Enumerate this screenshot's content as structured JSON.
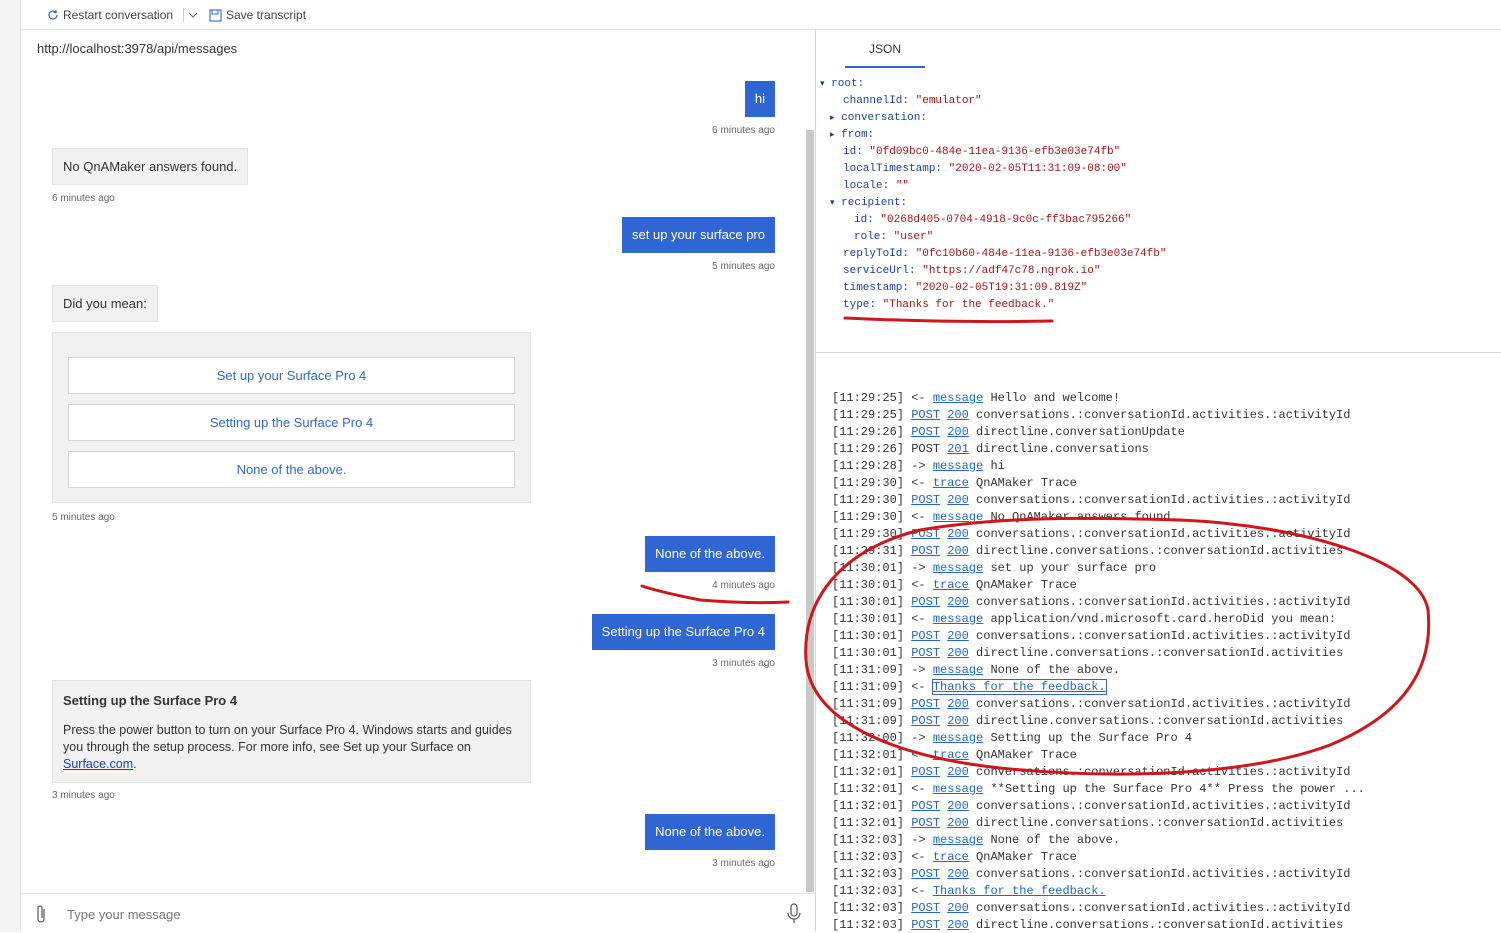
{
  "toolbar": {
    "restart_label": "Restart conversation",
    "save_label": "Save transcript"
  },
  "chat": {
    "endpoint": "http://localhost:3978/api/messages",
    "messages": [
      {
        "from": "user",
        "text": "hi",
        "time": "6 minutes ago"
      },
      {
        "from": "bot",
        "text": "No QnAMaker answers found.",
        "time": "6 minutes ago"
      },
      {
        "from": "user",
        "text": "set up your surface pro",
        "time": "5 minutes ago"
      },
      {
        "from": "bot",
        "text": "Did you mean:",
        "time": ""
      },
      {
        "from": "user",
        "text": "None of the above.",
        "time": "4 minutes ago"
      },
      {
        "from": "user",
        "text": "Setting up the Surface Pro 4",
        "time": "3 minutes ago"
      },
      {
        "from": "user",
        "text": "None of the above.",
        "time": "3 minutes ago"
      }
    ],
    "card": {
      "buttons": [
        "Set up your Surface Pro 4",
        "Setting up the Surface Pro 4",
        "None of the above."
      ],
      "time": "5 minutes ago"
    },
    "answer": {
      "title": "Setting up the Surface Pro 4",
      "body": "Press the power button to turn on your Surface Pro 4. Windows starts and guides you through the setup process. For more info, see Set up your Surface on ",
      "link": "Surface.com",
      "end": ".",
      "time": "3 minutes ago"
    },
    "input_placeholder": "Type your message"
  },
  "inspector": {
    "tab": "JSON",
    "json_lines": [
      {
        "arrow": "▾",
        "key": "root:",
        "val": ""
      },
      {
        "arrow": "",
        "key": "channelId:",
        "val": "\"emulator\""
      },
      {
        "arrow": "▸",
        "key": "conversation:",
        "val": ""
      },
      {
        "arrow": "▸",
        "key": "from:",
        "val": ""
      },
      {
        "arrow": "",
        "key": "id:",
        "val": "\"0fd09bc0-484e-11ea-9136-efb3e03e74fb\""
      },
      {
        "arrow": "",
        "key": "localTimestamp:",
        "val": "\"2020-02-05T11:31:09-08:00\""
      },
      {
        "arrow": "",
        "key": "locale:",
        "val": "\"\""
      },
      {
        "arrow": "▾",
        "key": "recipient:",
        "val": ""
      },
      {
        "arrow": "",
        "key": "id:",
        "val": "\"0268d405-0704-4918-9c0c-ff3bac795266\""
      },
      {
        "arrow": "",
        "key": "role:",
        "val": "\"user\""
      },
      {
        "arrow": "",
        "key": "replyToId:",
        "val": "\"0fc10b60-484e-11ea-9136-efb3e03e74fb\""
      },
      {
        "arrow": "",
        "key": "serviceUrl:",
        "val": "\"https://adf47c78.ngrok.io\""
      },
      {
        "arrow": "",
        "key": "timestamp:",
        "val": "\"2020-02-05T19:31:09.819Z\""
      },
      {
        "arrow": "",
        "key": "type:",
        "val": "\"Thanks for the feedback.\""
      }
    ]
  },
  "log": [
    {
      "t": "[11:29:25]",
      "d": "<-",
      "tag": "message",
      "code": "",
      "rest": "Hello and welcome!"
    },
    {
      "t": "[11:29:25]",
      "d": "",
      "tag": "POST",
      "code": "200",
      "rest": "conversations.:conversationId.activities.:activityId"
    },
    {
      "t": "[11:29:26]",
      "d": "",
      "tag": "POST",
      "code": "200",
      "rest": "directline.conversationUpdate"
    },
    {
      "t": "[11:29:26]",
      "d": "",
      "tag": "POST",
      "plain": true,
      "code": "201",
      "rest": "directline.conversations"
    },
    {
      "t": "[11:29:28]",
      "d": "->",
      "tag": "message",
      "code": "",
      "rest": "hi"
    },
    {
      "t": "[11:29:30]",
      "d": "<-",
      "tag": "trace",
      "code": "",
      "rest": "QnAMaker Trace"
    },
    {
      "t": "[11:29:30]",
      "d": "",
      "tag": "POST",
      "code": "200",
      "rest": "conversations.:conversationId.activities.:activityId"
    },
    {
      "t": "[11:29:30]",
      "d": "<-",
      "tag": "message",
      "code": "",
      "rest": "No QnAMaker answers found."
    },
    {
      "t": "[11:29:30]",
      "d": "",
      "tag": "POST",
      "code": "200",
      "rest": "conversations.:conversationId.activities.:activityId"
    },
    {
      "t": "[11:29:31]",
      "d": "",
      "tag": "POST",
      "code": "200",
      "rest": "directline.conversations.:conversationId.activities"
    },
    {
      "t": "[11:30:01]",
      "d": "->",
      "tag": "message",
      "code": "",
      "rest": "set up your surface pro"
    },
    {
      "t": "[11:30:01]",
      "d": "<-",
      "tag": "trace",
      "code": "",
      "rest": "QnAMaker Trace"
    },
    {
      "t": "[11:30:01]",
      "d": "",
      "tag": "POST",
      "code": "200",
      "rest": "conversations.:conversationId.activities.:activityId"
    },
    {
      "t": "[11:30:01]",
      "d": "<-",
      "tag": "message",
      "code": "",
      "rest": "application/vnd.microsoft.card.heroDid you mean:"
    },
    {
      "t": "[11:30:01]",
      "d": "",
      "tag": "POST",
      "code": "200",
      "rest": "conversations.:conversationId.activities.:activityId"
    },
    {
      "t": "[11:30:01]",
      "d": "",
      "tag": "POST",
      "code": "200",
      "rest": "directline.conversations.:conversationId.activities"
    },
    {
      "t": "[11:31:09]",
      "d": "->",
      "tag": "message",
      "code": "",
      "rest": "None of the above."
    },
    {
      "t": "[11:31:09]",
      "d": "<-",
      "tag": "Thanks for the feedback.",
      "selected": true,
      "code": "",
      "rest": ""
    },
    {
      "t": "[11:31:09]",
      "d": "",
      "tag": "POST",
      "code": "200",
      "rest": "conversations.:conversationId.activities.:activityId"
    },
    {
      "t": "[11:31:09]",
      "d": "",
      "tag": "POST",
      "code": "200",
      "rest": "directline.conversations.:conversationId.activities"
    },
    {
      "t": "[11:32:00]",
      "d": "->",
      "tag": "message",
      "code": "",
      "rest": "Setting up the Surface Pro 4"
    },
    {
      "t": "[11:32:01]",
      "d": "<-",
      "tag": "trace",
      "code": "",
      "rest": "QnAMaker Trace"
    },
    {
      "t": "[11:32:01]",
      "d": "",
      "tag": "POST",
      "code": "200",
      "rest": "conversations.:conversationId.activities.:activityId"
    },
    {
      "t": "[11:32:01]",
      "d": "<-",
      "tag": "message",
      "code": "",
      "rest": "**Setting up the Surface Pro 4** Press the power ..."
    },
    {
      "t": "[11:32:01]",
      "d": "",
      "tag": "POST",
      "code": "200",
      "rest": "conversations.:conversationId.activities.:activityId"
    },
    {
      "t": "[11:32:01]",
      "d": "",
      "tag": "POST",
      "code": "200",
      "rest": "directline.conversations.:conversationId.activities"
    },
    {
      "t": "[11:32:03]",
      "d": "->",
      "tag": "message",
      "code": "",
      "rest": "None of the above."
    },
    {
      "t": "[11:32:03]",
      "d": "<-",
      "tag": "trace",
      "code": "",
      "rest": "QnAMaker Trace"
    },
    {
      "t": "[11:32:03]",
      "d": "",
      "tag": "POST",
      "code": "200",
      "rest": "conversations.:conversationId.activities.:activityId"
    },
    {
      "t": "[11:32:03]",
      "d": "<-",
      "tag": "Thanks for the feedback.",
      "code": "",
      "rest": ""
    },
    {
      "t": "[11:32:03]",
      "d": "",
      "tag": "POST",
      "code": "200",
      "rest": "conversations.:conversationId.activities.:activityId"
    },
    {
      "t": "[11:32:03]",
      "d": "",
      "tag": "POST",
      "code": "200",
      "rest": "directline.conversations.:conversationId.activities"
    }
  ],
  "annotation_color": "#d0161b",
  "accent_color": "#2f66d4"
}
